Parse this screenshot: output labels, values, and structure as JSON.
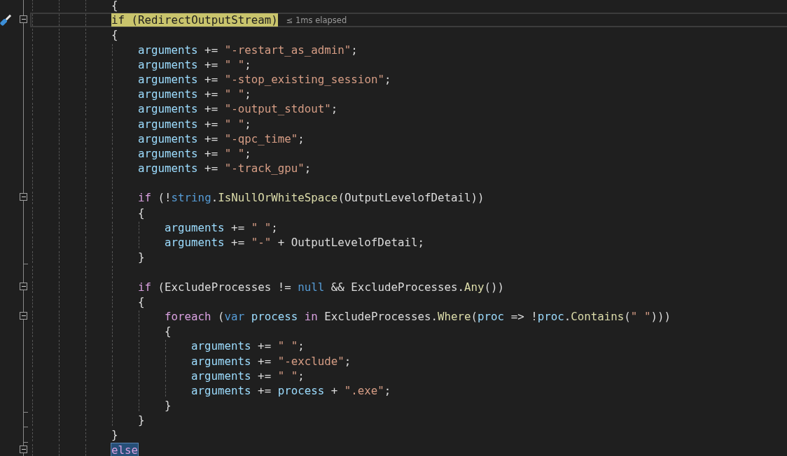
{
  "editor": {
    "lines": [
      {
        "kind": "code",
        "tokens": [
          {
            "text": "{",
            "kind": "punct"
          }
        ]
      },
      {
        "kind": "code",
        "current": true,
        "tool_glyph": true,
        "collapsible": true,
        "hint": "≤ 1ms elapsed",
        "tokens": [
          {
            "text": "if (RedirectOutputStream)",
            "kind": "usage"
          }
        ]
      },
      {
        "kind": "code",
        "tokens": [
          {
            "text": "{",
            "kind": "punct"
          }
        ],
        "children": [
          {
            "kind": "code",
            "tokens": [
              {
                "text": "arguments",
                "kind": "variable"
              },
              {
                "text": " += ",
                "kind": "punct"
              },
              {
                "text": "\"-restart_as_admin\"",
                "kind": "string"
              },
              {
                "text": ";",
                "kind": "punct"
              }
            ]
          },
          {
            "kind": "code",
            "tokens": [
              {
                "text": "arguments",
                "kind": "variable"
              },
              {
                "text": " += ",
                "kind": "punct"
              },
              {
                "text": "\" \"",
                "kind": "string"
              },
              {
                "text": ";",
                "kind": "punct"
              }
            ]
          },
          {
            "kind": "code",
            "tokens": [
              {
                "text": "arguments",
                "kind": "variable"
              },
              {
                "text": " += ",
                "kind": "punct"
              },
              {
                "text": "\"-stop_existing_session\"",
                "kind": "string"
              },
              {
                "text": ";",
                "kind": "punct"
              }
            ]
          },
          {
            "kind": "code",
            "tokens": [
              {
                "text": "arguments",
                "kind": "variable"
              },
              {
                "text": " += ",
                "kind": "punct"
              },
              {
                "text": "\" \"",
                "kind": "string"
              },
              {
                "text": ";",
                "kind": "punct"
              }
            ]
          },
          {
            "kind": "code",
            "tokens": [
              {
                "text": "arguments",
                "kind": "variable"
              },
              {
                "text": " += ",
                "kind": "punct"
              },
              {
                "text": "\"-output_stdout\"",
                "kind": "string"
              },
              {
                "text": ";",
                "kind": "punct"
              }
            ]
          },
          {
            "kind": "code",
            "tokens": [
              {
                "text": "arguments",
                "kind": "variable"
              },
              {
                "text": " += ",
                "kind": "punct"
              },
              {
                "text": "\" \"",
                "kind": "string"
              },
              {
                "text": ";",
                "kind": "punct"
              }
            ]
          },
          {
            "kind": "code",
            "tokens": [
              {
                "text": "arguments",
                "kind": "variable"
              },
              {
                "text": " += ",
                "kind": "punct"
              },
              {
                "text": "\"-qpc_time\"",
                "kind": "string"
              },
              {
                "text": ";",
                "kind": "punct"
              }
            ]
          },
          {
            "kind": "code",
            "tokens": [
              {
                "text": "arguments",
                "kind": "variable"
              },
              {
                "text": " += ",
                "kind": "punct"
              },
              {
                "text": "\" \"",
                "kind": "string"
              },
              {
                "text": ";",
                "kind": "punct"
              }
            ]
          },
          {
            "kind": "code",
            "tokens": [
              {
                "text": "arguments",
                "kind": "variable"
              },
              {
                "text": " += ",
                "kind": "punct"
              },
              {
                "text": "\"-track_gpu\"",
                "kind": "string"
              },
              {
                "text": ";",
                "kind": "punct"
              }
            ]
          },
          {
            "kind": "blank"
          },
          {
            "kind": "code",
            "collapsible": true,
            "tokens": [
              {
                "text": "if",
                "kind": "control"
              },
              {
                "text": " (!",
                "kind": "punct"
              },
              {
                "text": "string",
                "kind": "keyword"
              },
              {
                "text": ".",
                "kind": "punct"
              },
              {
                "text": "IsNullOrWhiteSpace",
                "kind": "method"
              },
              {
                "text": "(OutputLevelofDetail))",
                "kind": "punct"
              }
            ]
          },
          {
            "kind": "code",
            "tokens": [
              {
                "text": "{",
                "kind": "punct"
              }
            ],
            "children": [
              {
                "kind": "code",
                "tokens": [
                  {
                    "text": "arguments",
                    "kind": "variable"
                  },
                  {
                    "text": " += ",
                    "kind": "punct"
                  },
                  {
                    "text": "\" \"",
                    "kind": "string"
                  },
                  {
                    "text": ";",
                    "kind": "punct"
                  }
                ]
              },
              {
                "kind": "code",
                "tokens": [
                  {
                    "text": "arguments",
                    "kind": "variable"
                  },
                  {
                    "text": " += ",
                    "kind": "punct"
                  },
                  {
                    "text": "\"-\"",
                    "kind": "string"
                  },
                  {
                    "text": " + OutputLevelofDetail;",
                    "kind": "punct"
                  }
                ]
              }
            ]
          },
          {
            "kind": "code",
            "tokens": [
              {
                "text": "}",
                "kind": "punct"
              }
            ]
          },
          {
            "kind": "blank"
          },
          {
            "kind": "code",
            "collapsible": true,
            "tokens": [
              {
                "text": "if",
                "kind": "control"
              },
              {
                "text": " (ExcludeProcesses != ",
                "kind": "punct"
              },
              {
                "text": "null",
                "kind": "keyword"
              },
              {
                "text": " && ExcludeProcesses.",
                "kind": "punct"
              },
              {
                "text": "Any",
                "kind": "method"
              },
              {
                "text": "())",
                "kind": "punct"
              }
            ]
          },
          {
            "kind": "code",
            "tokens": [
              {
                "text": "{",
                "kind": "punct"
              }
            ],
            "children": [
              {
                "kind": "code",
                "collapsible": true,
                "tokens": [
                  {
                    "text": "foreach",
                    "kind": "control"
                  },
                  {
                    "text": " (",
                    "kind": "punct"
                  },
                  {
                    "text": "var",
                    "kind": "keyword"
                  },
                  {
                    "text": " process",
                    "kind": "variable"
                  },
                  {
                    "text": " in",
                    "kind": "control"
                  },
                  {
                    "text": " ExcludeProcesses.",
                    "kind": "punct"
                  },
                  {
                    "text": "Where",
                    "kind": "method"
                  },
                  {
                    "text": "(",
                    "kind": "punct"
                  },
                  {
                    "text": "proc",
                    "kind": "variable"
                  },
                  {
                    "text": " => !",
                    "kind": "punct"
                  },
                  {
                    "text": "proc",
                    "kind": "variable"
                  },
                  {
                    "text": ".",
                    "kind": "punct"
                  },
                  {
                    "text": "Contains",
                    "kind": "method"
                  },
                  {
                    "text": "(",
                    "kind": "punct"
                  },
                  {
                    "text": "\" \"",
                    "kind": "string"
                  },
                  {
                    "text": ")))",
                    "kind": "punct"
                  }
                ]
              },
              {
                "kind": "code",
                "tokens": [
                  {
                    "text": "{",
                    "kind": "punct"
                  }
                ],
                "children": [
                  {
                    "kind": "code",
                    "tokens": [
                      {
                        "text": "arguments",
                        "kind": "variable"
                      },
                      {
                        "text": " += ",
                        "kind": "punct"
                      },
                      {
                        "text": "\" \"",
                        "kind": "string"
                      },
                      {
                        "text": ";",
                        "kind": "punct"
                      }
                    ]
                  },
                  {
                    "kind": "code",
                    "tokens": [
                      {
                        "text": "arguments",
                        "kind": "variable"
                      },
                      {
                        "text": " += ",
                        "kind": "punct"
                      },
                      {
                        "text": "\"-exclude\"",
                        "kind": "string"
                      },
                      {
                        "text": ";",
                        "kind": "punct"
                      }
                    ]
                  },
                  {
                    "kind": "code",
                    "tokens": [
                      {
                        "text": "arguments",
                        "kind": "variable"
                      },
                      {
                        "text": " += ",
                        "kind": "punct"
                      },
                      {
                        "text": "\" \"",
                        "kind": "string"
                      },
                      {
                        "text": ";",
                        "kind": "punct"
                      }
                    ]
                  },
                  {
                    "kind": "code",
                    "tokens": [
                      {
                        "text": "arguments",
                        "kind": "variable"
                      },
                      {
                        "text": " += ",
                        "kind": "punct"
                      },
                      {
                        "text": "process",
                        "kind": "variable"
                      },
                      {
                        "text": " + ",
                        "kind": "punct"
                      },
                      {
                        "text": "\".exe\"",
                        "kind": "string"
                      },
                      {
                        "text": ";",
                        "kind": "punct"
                      }
                    ]
                  }
                ]
              },
              {
                "kind": "code",
                "tokens": [
                  {
                    "text": "}",
                    "kind": "punct"
                  }
                ]
              }
            ]
          },
          {
            "kind": "code",
            "tokens": [
              {
                "text": "}",
                "kind": "punct"
              }
            ]
          }
        ]
      },
      {
        "kind": "code",
        "tokens": [
          {
            "text": "}",
            "kind": "punct"
          }
        ]
      },
      {
        "kind": "code",
        "collapsible": true,
        "tokens": [
          {
            "text": "else",
            "kind": "selection"
          }
        ]
      }
    ]
  }
}
